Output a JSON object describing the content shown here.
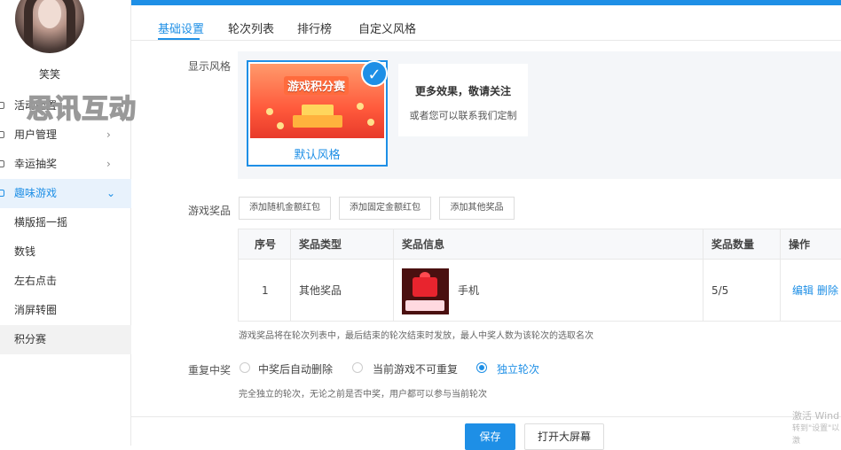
{
  "sidebar": {
    "username": "笑笑",
    "watermark": "思讯互动",
    "items": [
      {
        "label": "活动配置",
        "chevron": ""
      },
      {
        "label": "用户管理",
        "chevron": "›"
      },
      {
        "label": "幸运抽奖",
        "chevron": "›"
      },
      {
        "label": "趣味游戏",
        "chevron": "⌄"
      }
    ],
    "sub_items": [
      "横版摇一摇",
      "数钱",
      "左右点击",
      "消屏转圈",
      "积分赛"
    ]
  },
  "tabs": [
    "基础设置",
    "轮次列表",
    "排行榜",
    "自定义风格"
  ],
  "style": {
    "label": "显示风格",
    "card_banner_title": "游戏积分赛",
    "card_label": "默认风格",
    "more_title": "更多效果，敬请关注",
    "more_sub": "或者您可以联系我们定制"
  },
  "prizes": {
    "label": "游戏奖品",
    "buttons": [
      "添加随机金额红包",
      "添加固定金额红包",
      "添加其他奖品"
    ],
    "columns": [
      "序号",
      "奖品类型",
      "奖品信息",
      "奖品数量",
      "操作"
    ],
    "rows": [
      {
        "index": "1",
        "type": "其他奖品",
        "name": "手机",
        "qty": "5/5",
        "edit": "编辑",
        "delete": "删除"
      }
    ],
    "hint": "游戏奖品将在轮次列表中，最后结束的轮次结束时发放，最人中奖人数为该轮次的选取名次"
  },
  "repeat": {
    "label": "重复中奖",
    "options": [
      "中奖后自动删除",
      "当前游戏不可重复",
      "独立轮次"
    ],
    "selected": 2,
    "hint": "完全独立的轮次，无论之前是否中奖，用户都可以参与当前轮次"
  },
  "footer": {
    "save": "保存",
    "big_screen": "打开大屏幕"
  },
  "os_notice": {
    "line1": "激活 Wind",
    "line2": "转到\"设置\"以激"
  },
  "colors": {
    "accent": "#1e8fe6",
    "active_bg": "#e8f2fc"
  }
}
